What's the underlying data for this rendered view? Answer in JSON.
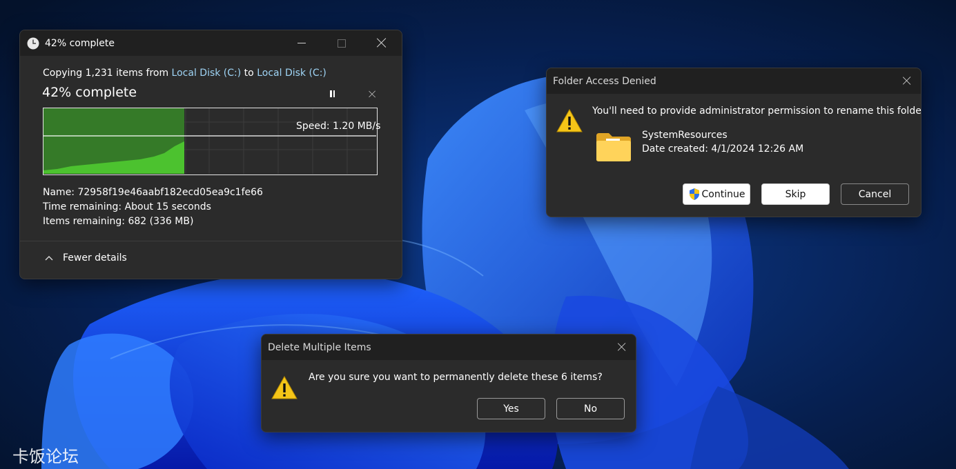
{
  "copy_window": {
    "title": "42% complete",
    "progress_percent": 42,
    "desc_prefix": "Copying 1,231 items from ",
    "source": "Local Disk (C:)",
    "desc_middle": " to ",
    "destination": "Local Disk (C:)",
    "heading": "42% complete",
    "speed": "Speed: 1.20 MB/s",
    "name": "Name:  72958f19e46aabf182ecd05ea9c1fe66",
    "time_remaining": "Time remaining:  About 15 seconds",
    "items_remaining": "Items remaining:  682 (336 MB)",
    "fewer_details": "Fewer details"
  },
  "access_dialog": {
    "title": "Folder Access Denied",
    "message": "You'll need to provide administrator permission to rename this folder",
    "folder_name": "SystemResources",
    "date_created": "Date created: 4/1/2024 12:26 AM",
    "continue_label": "Continue",
    "skip_label": "Skip",
    "cancel_label": "Cancel"
  },
  "delete_dialog": {
    "title": "Delete Multiple Items",
    "message": "Are you sure you want to permanently delete these 6 items?",
    "yes_label": "Yes",
    "no_label": "No"
  },
  "watermark": "卡饭论坛",
  "colors": {
    "accent_link": "#9fd4f5",
    "progress_green": "#3fb82a",
    "progress_dark_green": "#357a28",
    "dialog_bg": "#2b2b2b",
    "warning_yellow": "#f5c518"
  },
  "icons": [
    "clock-icon",
    "minimize-icon",
    "maximize-icon",
    "close-icon",
    "pause-icon",
    "stop-icon",
    "chevron-up-icon",
    "warning-icon",
    "folder-icon",
    "uac-shield-icon"
  ]
}
